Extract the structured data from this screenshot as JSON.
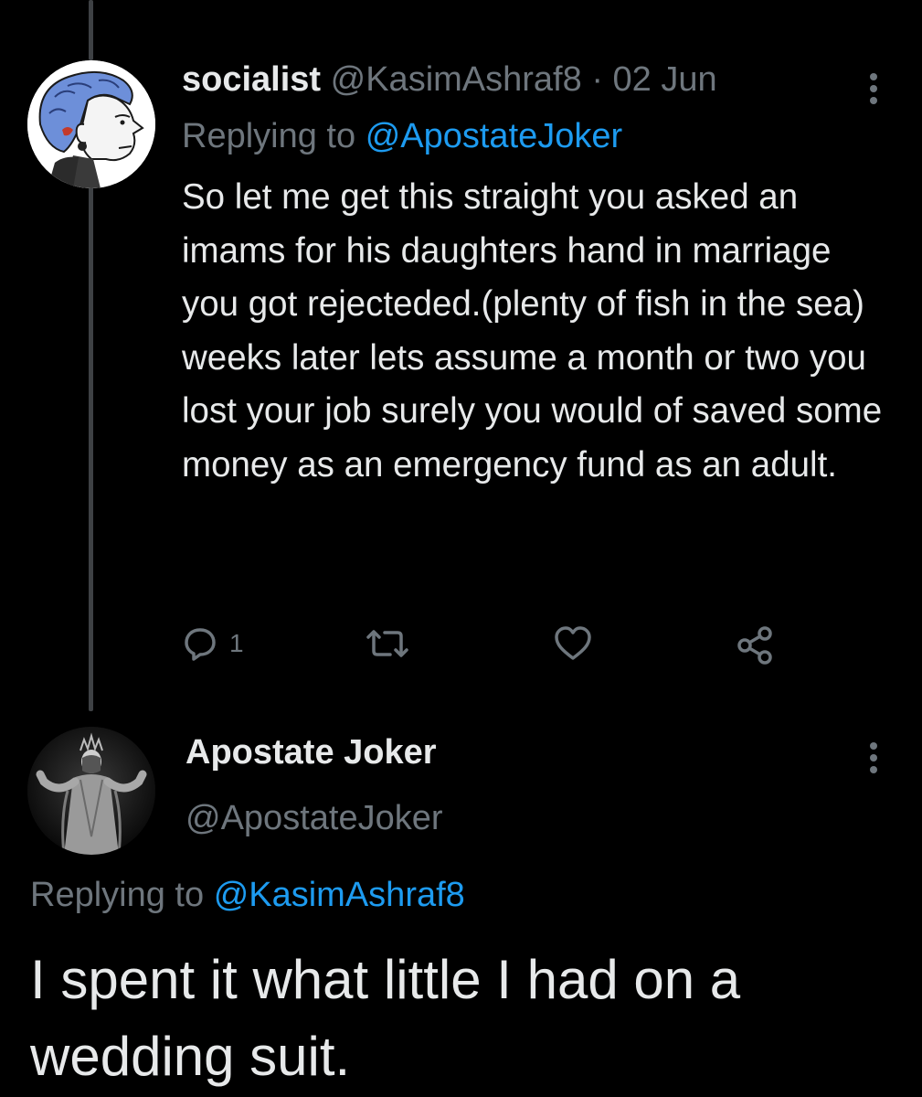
{
  "reply_tweet": {
    "display_name": "socialist",
    "handle": "@KasimAshraf8",
    "separator": "·",
    "date": "02 Jun",
    "replying_to_label": "Replying to",
    "replying_to_handle": "@ApostateJoker",
    "text": "So let me get this straight you asked an imams for his daughters hand in marriage you got rejecteded.(plenty of fish in the sea) weeks later lets assume a month or two you lost your job surely you would of saved some money as an emergency fund as an adult.",
    "actions": {
      "reply_icon": "comment-icon",
      "reply_count": "1",
      "retweet_icon": "retweet-icon",
      "like_icon": "heart-icon",
      "share_icon": "share-icon"
    }
  },
  "main_tweet": {
    "display_name": "Apostate Joker",
    "handle": "@ApostateJoker",
    "replying_to_label": "Replying to",
    "replying_to_handle": "@KasimAshraf8",
    "text": "I spent it what little I had on a wedding suit."
  },
  "colors": {
    "background": "#000000",
    "text": "#e7e9ea",
    "muted": "#6e767d",
    "link": "#1d9bf0",
    "thread_line": "#3e4144"
  }
}
